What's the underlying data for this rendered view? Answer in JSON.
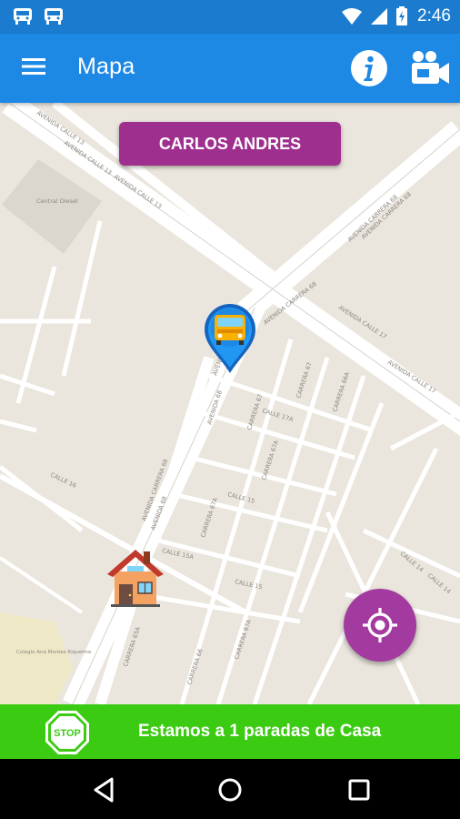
{
  "status_bar": {
    "time": "2:46",
    "icons": [
      "bus-icon",
      "bus-icon",
      "wifi-icon",
      "signal-icon",
      "battery-icon"
    ]
  },
  "app_bar": {
    "title": "Mapa",
    "menu_icon": "hamburger-menu-icon",
    "info_icon": "info-icon",
    "video_icon": "video-camera-icon"
  },
  "map": {
    "student_name": "CARLOS ANDRES",
    "street_labels": [
      "AVENIDA CALLE 13",
      "AVENIDA CALLE 13",
      "AVENIDA CARRERA 68",
      "AVENIDA CARRERA 68",
      "AVENIDA CALLE 17",
      "AVENIDA CARRERA 68",
      "AVENIDA CARRERA 68",
      "AVENIDA 68",
      "CALLE 17A",
      "CARRERA 67",
      "CARRERA 66A",
      "CARRERA 67A",
      "CALLE 15",
      "CALLE 16",
      "CALLE 15A",
      "CARRERA 67A",
      "CALLE 15",
      "CALLE 14",
      "CARRERA 65A",
      "CARRERA 66",
      "CARRERA 67A",
      "CALLE 13A",
      "Central Diesel",
      "Colegio Ana Montes Riquelme"
    ],
    "bus_marker_icon": "school-bus-icon",
    "house_marker_icon": "house-icon",
    "locate_icon": "my-location-icon",
    "colors": {
      "road": "#FFFFFF",
      "ground": "#EAE5DD",
      "accent": "#A33A9F"
    }
  },
  "bottom_bar": {
    "stop_label": "STOP",
    "message": "Estamos a 1 paradas de Casa"
  },
  "nav_bar": {
    "icons": [
      "back-icon",
      "home-icon",
      "recents-icon"
    ]
  }
}
